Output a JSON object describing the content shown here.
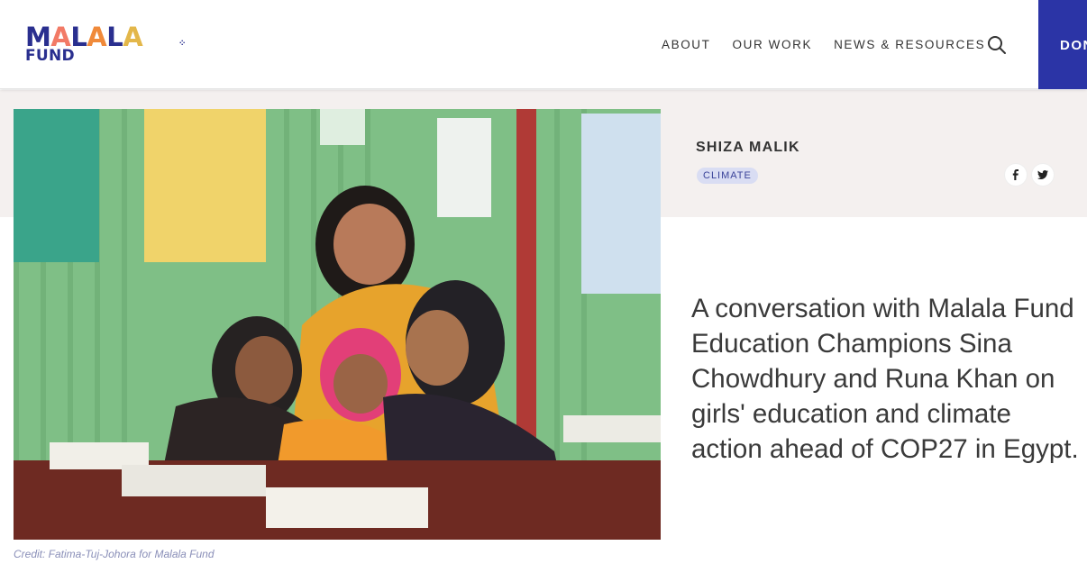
{
  "header": {
    "logo": {
      "top": "MALALA",
      "bottom": "FUND"
    },
    "nav": [
      "ABOUT",
      "OUR WORK",
      "NEWS & RESOURCES"
    ],
    "donate_label": "DONATE",
    "colors": {
      "brand_blue": "#2a2f8f",
      "donate_bg": "#2b34a6"
    }
  },
  "article": {
    "author": "SHIZA MALIK",
    "tag": "CLIMATE",
    "share": [
      "facebook-icon",
      "twitter-icon"
    ],
    "headline": "A conversation with Malala Fund Education Champions Sina Chowdhury and Runa Khan on girls' education and climate action ahead of COP27 in Egypt.",
    "photo_credit": "Credit: Fatima-Tuj-Johora for Malala Fund"
  }
}
